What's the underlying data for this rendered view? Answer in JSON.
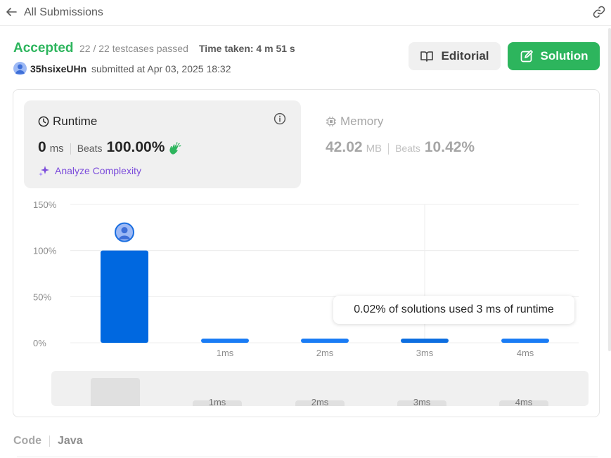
{
  "nav": {
    "back_label": "All Submissions"
  },
  "submission": {
    "status": "Accepted",
    "testcases": "22 / 22 testcases passed",
    "time_taken": "Time taken: 4 m 51 s",
    "username": "35hsixeUHn",
    "submitted_at": "submitted at Apr 03, 2025 18:32"
  },
  "buttons": {
    "editorial": "Editorial",
    "solution": "Solution"
  },
  "runtime": {
    "title": "Runtime",
    "value": "0",
    "unit": "ms",
    "beats_label": "Beats",
    "beats_value": "100.00%",
    "analyze_label": "Analyze Complexity"
  },
  "memory": {
    "title": "Memory",
    "value": "42.02",
    "unit": "MB",
    "beats_label": "Beats",
    "beats_value": "10.42%"
  },
  "chart_data": {
    "type": "bar",
    "categories": [
      "",
      "1ms",
      "2ms",
      "3ms",
      "4ms"
    ],
    "values": [
      100,
      0.02,
      0.02,
      0.02,
      0.02
    ],
    "yticks": [
      "0%",
      "50%",
      "100%",
      "150%"
    ],
    "ylim": [
      0,
      150
    ],
    "grid": true,
    "user_marker_category_index": 0,
    "highlight_category_index": 3,
    "tooltip": "0.02% of solutions used 3 ms of runtime",
    "colors": {
      "bar": "#1a7cf5",
      "bar_selected": "#0068e0",
      "bar_highlight": "#0d6ee0"
    }
  },
  "range_selector": {
    "labels": [
      "1ms",
      "2ms",
      "3ms",
      "4ms"
    ]
  },
  "footer": {
    "code_label": "Code",
    "language": "Java"
  },
  "colors": {
    "accent_green": "#2db55d",
    "analyze_purple": "#7c4ddb"
  }
}
